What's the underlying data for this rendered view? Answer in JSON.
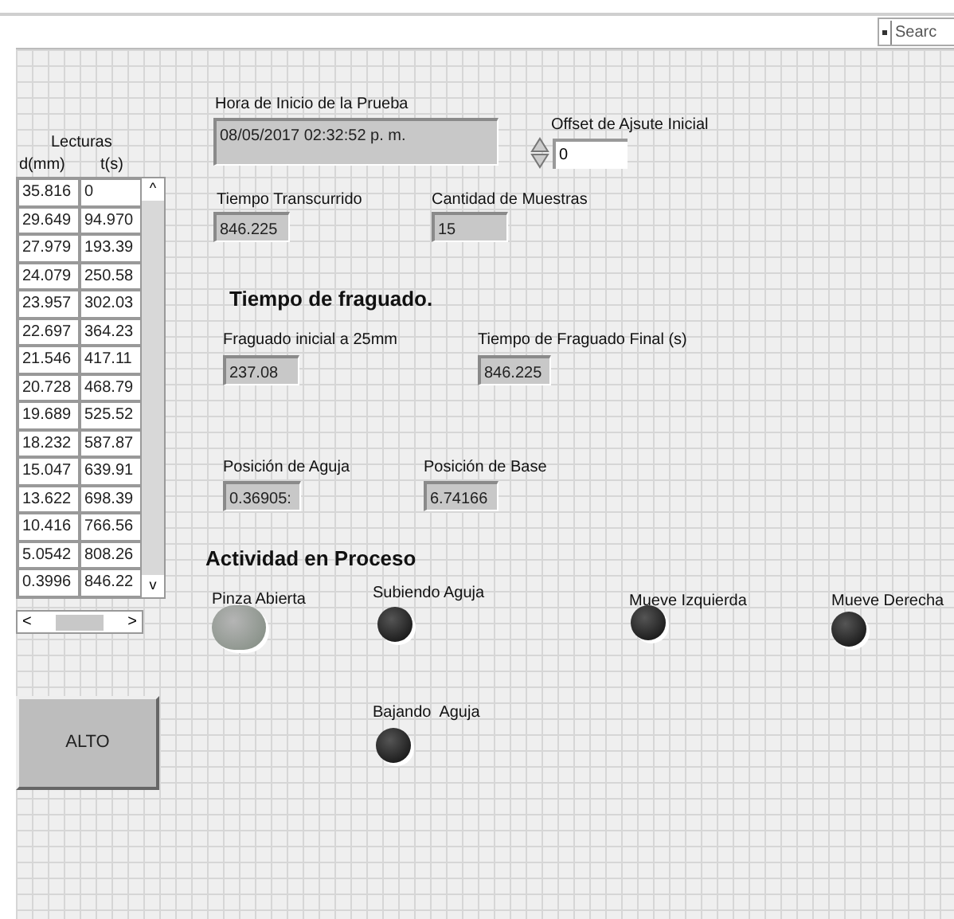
{
  "toolbar": {
    "search": {
      "placeholder": "Searc"
    }
  },
  "table": {
    "title": "Lecturas",
    "columns": [
      "d(mm)",
      "t(s)"
    ],
    "rows": [
      [
        "35.816",
        "0"
      ],
      [
        "29.649",
        "94.970"
      ],
      [
        "27.979",
        "193.39"
      ],
      [
        "24.079",
        "250.58"
      ],
      [
        "23.957",
        "302.03"
      ],
      [
        "22.697",
        "364.23"
      ],
      [
        "21.546",
        "417.11"
      ],
      [
        "20.728",
        "468.79"
      ],
      [
        "19.689",
        "525.52"
      ],
      [
        "18.232",
        "587.87"
      ],
      [
        "15.047",
        "639.91"
      ],
      [
        "13.622",
        "698.39"
      ],
      [
        "10.416",
        "766.56"
      ],
      [
        "5.0542",
        "808.26"
      ],
      [
        "0.3996",
        "846.22"
      ]
    ],
    "scroll_up": "^",
    "scroll_down": "v",
    "scroll_left": "<",
    "scroll_right": ">"
  },
  "start_time": {
    "label": "Hora de Inicio de la Prueba",
    "value": "08/05/2017 02:32:52 p. m."
  },
  "offset": {
    "label": "Offset de Ajsute Inicial",
    "value": "0"
  },
  "elapsed": {
    "label": "Tiempo Transcurrido",
    "value": "846.225"
  },
  "samples": {
    "label": "Cantidad de Muestras",
    "value": "15"
  },
  "setting": {
    "title": "Tiempo de fraguado.",
    "initial": {
      "label": "Fraguado inicial a 25mm",
      "value": "237.08"
    },
    "final": {
      "label": "Tiempo de Fraguado Final (s)",
      "value": "846.225"
    }
  },
  "needle_position": {
    "label": "Posición de Aguja",
    "value": "0.36905:"
  },
  "base_position": {
    "label": "Posición de Base",
    "value": "6.74166"
  },
  "activity": {
    "title": "Actividad en Proceso",
    "indicators": [
      {
        "label": "Pinza Abierta",
        "on": true
      },
      {
        "label": "Subiendo Aguja",
        "on": false
      },
      {
        "label": "Mueve Izquierda",
        "on": false
      },
      {
        "label": "Mueve Derecha",
        "on": false
      },
      {
        "label": "Bajando  Aguja",
        "on": false
      }
    ]
  },
  "stop_button": {
    "label": "ALTO"
  }
}
